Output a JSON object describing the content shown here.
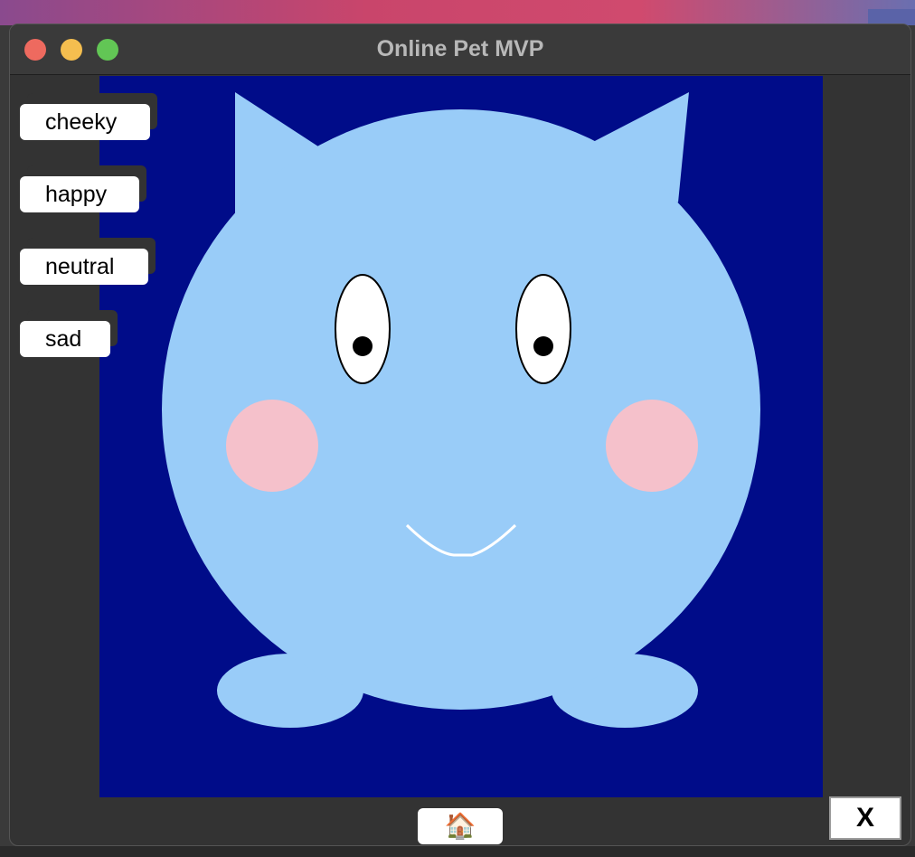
{
  "window": {
    "title": "Online Pet MVP"
  },
  "mood_buttons": [
    {
      "label": "cheeky"
    },
    {
      "label": "happy"
    },
    {
      "label": "neutral"
    },
    {
      "label": "sad"
    }
  ],
  "pet": {
    "mood": "happy",
    "body_color": "#99ccf8",
    "cheek_color": "#f5c1cb",
    "background_color": "#000c89"
  },
  "footer": {
    "home_icon": "🏠",
    "close_label": "X"
  }
}
